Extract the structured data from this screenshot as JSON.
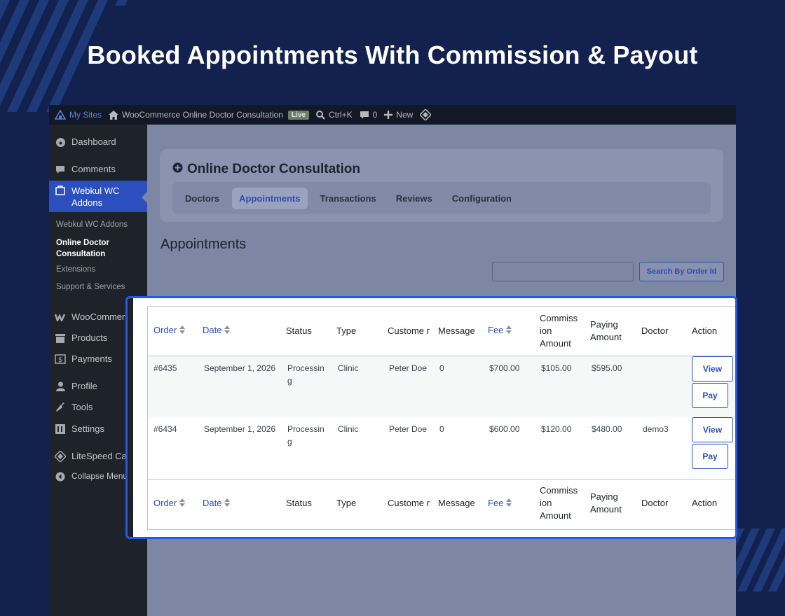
{
  "banner": {
    "title": "Booked Appointments With Commission & Payout"
  },
  "adminbar": {
    "my_sites": "My Sites",
    "site_name": "WooCommerce Online Doctor Consultation",
    "live_badge": "Live",
    "search_shortcut": "Ctrl+K",
    "comments_count": "0",
    "new_label": "New"
  },
  "sidebar": {
    "items": [
      {
        "label": "Dashboard",
        "icon": "dashboard-icon"
      },
      {
        "label": "Comments",
        "icon": "comment-icon"
      },
      {
        "label": "Webkul WC Addons",
        "icon": "addons-icon"
      },
      {
        "label": "WooCommerce",
        "icon": "woo-icon"
      },
      {
        "label": "Products",
        "icon": "archive-icon"
      },
      {
        "label": "Payments",
        "icon": "payments-icon"
      },
      {
        "label": "Profile",
        "icon": "user-icon"
      },
      {
        "label": "Tools",
        "icon": "wrench-icon"
      },
      {
        "label": "Settings",
        "icon": "settings-icon"
      },
      {
        "label": "LiteSpeed Cache",
        "icon": "litespeed-icon"
      },
      {
        "label": "Collapse Menu",
        "icon": "collapse-icon"
      }
    ],
    "submenu": [
      {
        "label": "Webkul WC Addons"
      },
      {
        "label": "Online Doctor Consultation"
      },
      {
        "label": "Extensions"
      },
      {
        "label": "Support & Services"
      }
    ]
  },
  "plugin": {
    "title": "Online Doctor Consultation",
    "tabs": [
      {
        "label": "Doctors"
      },
      {
        "label": "Appointments"
      },
      {
        "label": "Transactions"
      },
      {
        "label": "Reviews"
      },
      {
        "label": "Configuration"
      }
    ],
    "active_tab": "Appointments"
  },
  "page": {
    "heading": "Appointments",
    "search_placeholder": "",
    "search_button": "Search By Order Id"
  },
  "table": {
    "columns": [
      {
        "label": "Order",
        "sortable": true
      },
      {
        "label": "Date",
        "sortable": true
      },
      {
        "label": "Status",
        "sortable": false
      },
      {
        "label": "Type",
        "sortable": false
      },
      {
        "label": "Custome r",
        "sortable": false
      },
      {
        "label": "Message",
        "sortable": false
      },
      {
        "label": "Fee",
        "sortable": true
      },
      {
        "label": "Commiss ion Amount",
        "sortable": false
      },
      {
        "label": "Paying Amount",
        "sortable": false
      },
      {
        "label": "Doctor",
        "sortable": false
      },
      {
        "label": "Action",
        "sortable": false
      }
    ],
    "rows": [
      {
        "order": "#6435",
        "date": "September 1, 2026",
        "status": "Processin g",
        "type": "Clinic",
        "customer": "Peter Doe",
        "message": "0",
        "fee": "$700.00",
        "commission": "$105.00",
        "paying": "$595.00",
        "doctor": "",
        "view_label": "View",
        "pay_label": "Pay"
      },
      {
        "order": "#6434",
        "date": "September 1, 2026",
        "status": "Processin g",
        "type": "Clinic",
        "customer": "Peter Doe",
        "message": "0",
        "fee": "$600.00",
        "commission": "$120.00",
        "paying": "$480.00",
        "doctor": "demo3",
        "view_label": "View",
        "pay_label": "Pay"
      }
    ]
  },
  "colors": {
    "background": "#13214e",
    "accent": "#2459e8",
    "link": "#2a4db8",
    "active_menu": "#2b4fbf"
  }
}
